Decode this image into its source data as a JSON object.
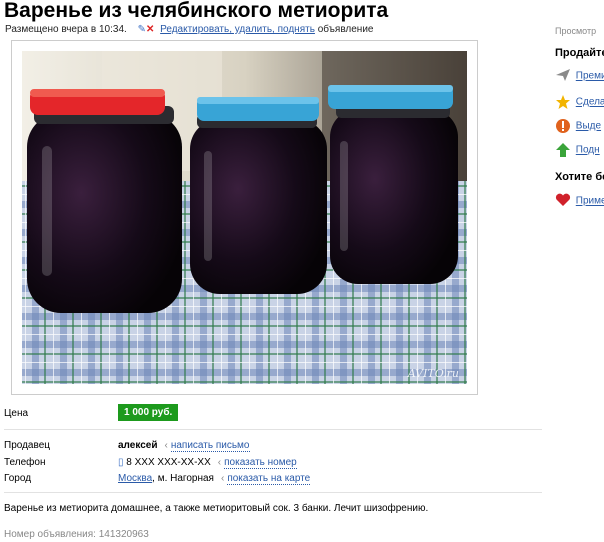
{
  "title": "Варенье из челябинского метиорита",
  "meta": {
    "posted": "Размещено вчера в 10:34.",
    "edit_link": "Редактировать, удалить, поднять",
    "suffix": "объявление"
  },
  "photo": {
    "watermark": "AVITO.ru"
  },
  "fields": {
    "price_label": "Цена",
    "price_value": "1 000 руб.",
    "seller_label": "Продавец",
    "seller_name": "алексей",
    "seller_action": "написать письмо",
    "phone_label": "Телефон",
    "phone_value": "8 XXX XXX-XX-XX",
    "phone_action": "показать номер",
    "city_label": "Город",
    "city_name": "Москва",
    "city_metro": ", м. Нагорная",
    "city_action": "показать на карте"
  },
  "description": "Варенье из метиорита домашнее, а также метиоритовый сок. 3 банки. Лечит шизофрению.",
  "ad_number": "Номер объявления: 141320963",
  "sidebar": {
    "header": "Просмотр",
    "sell_title": "Продайте",
    "items": [
      {
        "label": "Преми",
        "icon": "send-icon",
        "color": "#8a8a8a"
      },
      {
        "label": "Сдела",
        "icon": "star-icon",
        "color": "#f2b400"
      },
      {
        "label": "Выде",
        "icon": "highlight-icon",
        "color": "#e0621d"
      },
      {
        "label": "Подн",
        "icon": "up-arrow-icon",
        "color": "#3aa43a"
      }
    ],
    "want_title": "Хотите бо",
    "want_items": [
      {
        "label": "Приме",
        "icon": "heart-icon",
        "color": "#d0212b"
      }
    ]
  },
  "colors": {
    "price_badge": "#1d9a1d",
    "link": "#2a5aa8"
  }
}
